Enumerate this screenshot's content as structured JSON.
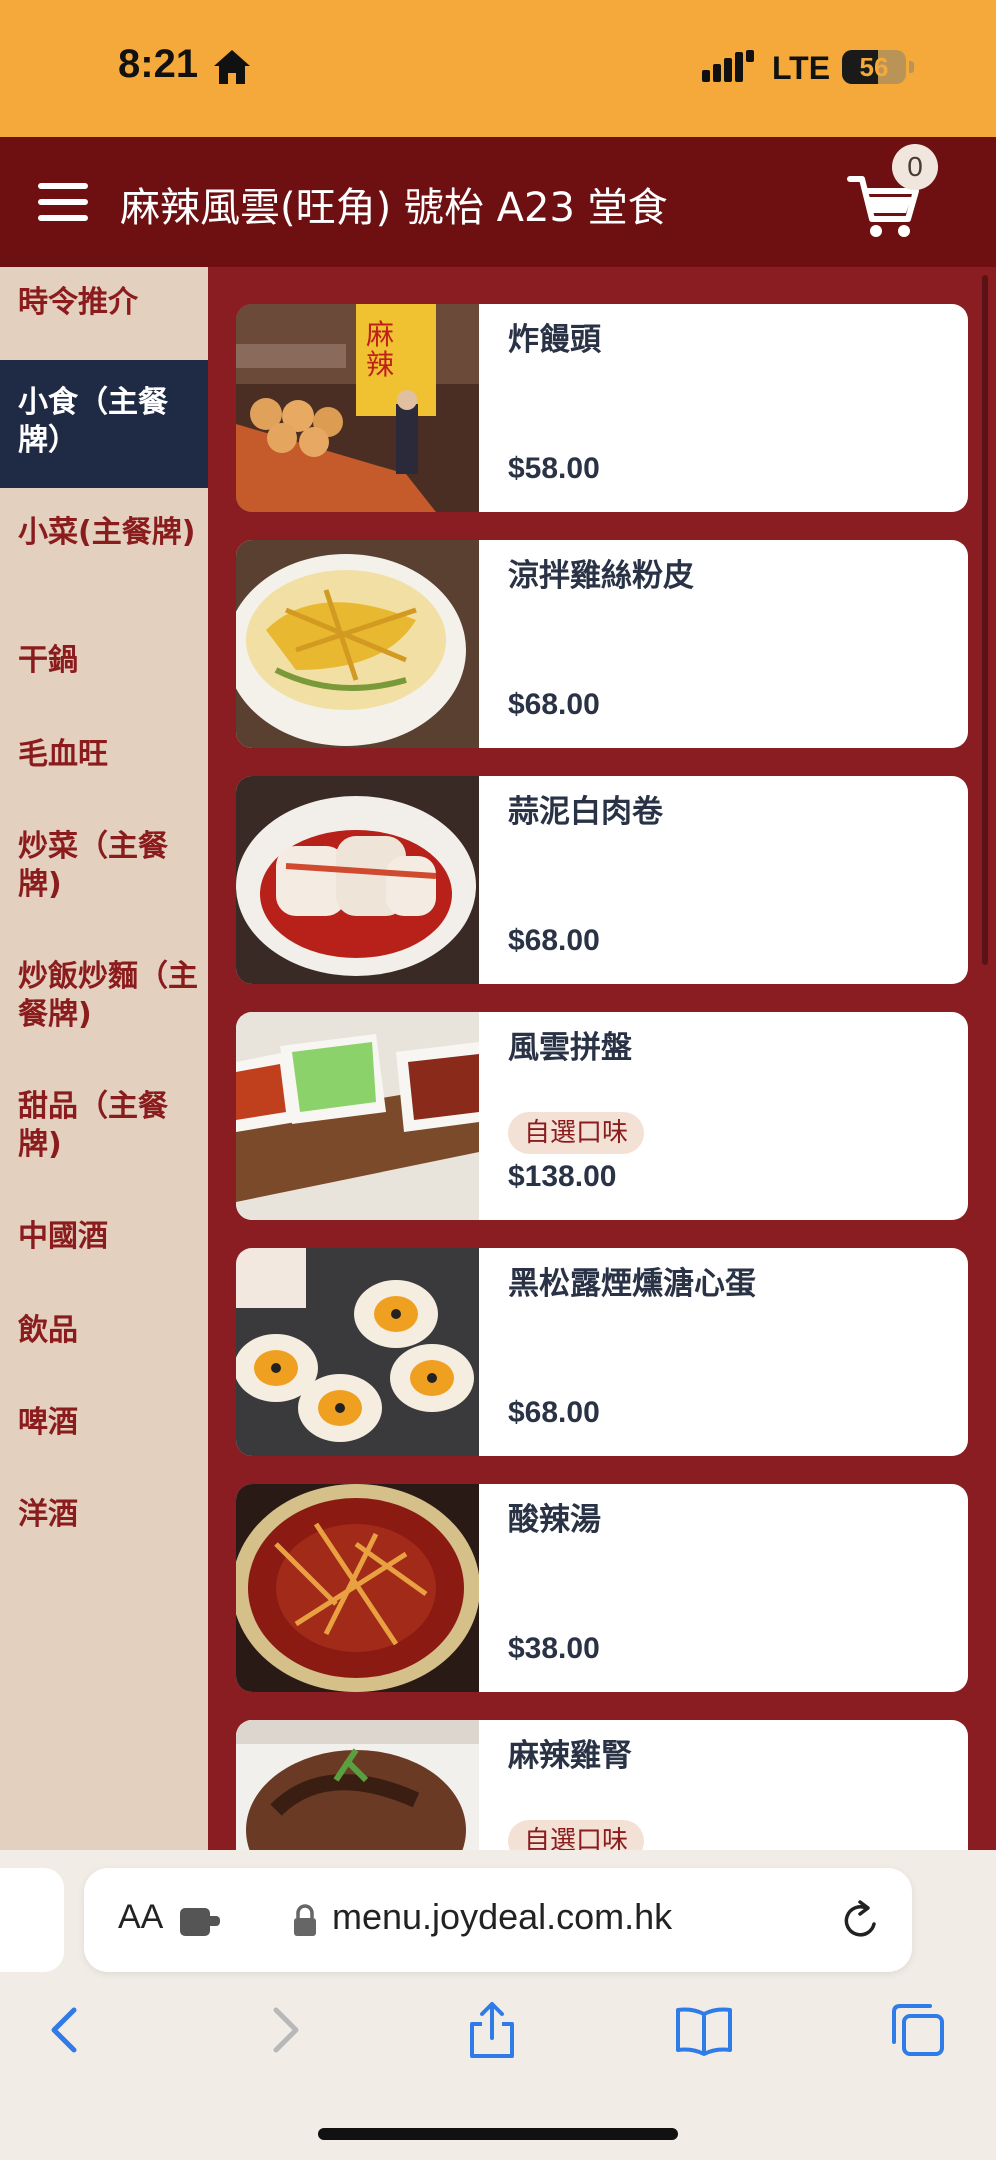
{
  "status_bar": {
    "time": "8:21",
    "network": "LTE",
    "battery_level": 56,
    "battery_text": "56"
  },
  "header": {
    "title": "麻辣風雲(旺角) 號枱 A23 堂食",
    "cart_count": "0"
  },
  "sidebar": {
    "items": [
      {
        "label": "時令推介",
        "active": false
      },
      {
        "label": "小食（主餐牌）",
        "active": true
      },
      {
        "label": "小菜(主餐牌)",
        "active": false
      },
      {
        "label": "干鍋",
        "active": false
      },
      {
        "label": "毛血旺",
        "active": false
      },
      {
        "label": "炒菜（主餐牌)",
        "active": false
      },
      {
        "label": "炒飯炒麵（主餐牌)",
        "active": false
      },
      {
        "label": "甜品（主餐牌)",
        "active": false
      },
      {
        "label": "中國酒",
        "active": false
      },
      {
        "label": "飲品",
        "active": false
      },
      {
        "label": "啤酒",
        "active": false
      },
      {
        "label": "洋酒",
        "active": false
      }
    ]
  },
  "menu_items": [
    {
      "name": "炸饅頭",
      "price": "$58.00",
      "tag": ""
    },
    {
      "name": "涼拌雞絲粉皮",
      "price": "$68.00",
      "tag": ""
    },
    {
      "name": "蒜泥白肉卷",
      "price": "$68.00",
      "tag": ""
    },
    {
      "name": "風雲拼盤",
      "price": "$138.00",
      "tag": "自選口味"
    },
    {
      "name": "黑松露煙燻溏心蛋",
      "price": "$68.00",
      "tag": ""
    },
    {
      "name": "酸辣湯",
      "price": "$38.00",
      "tag": ""
    },
    {
      "name": "麻辣雞腎",
      "price": "",
      "tag": "自選口味"
    }
  ],
  "browser": {
    "aa_label": "AA",
    "url": "menu.joydeal.com.hk"
  },
  "colors": {
    "status_bar": "#f4a93a",
    "header": "#6e0f12",
    "sidebar": "#e3d0bf",
    "sidebar_active": "#1f2a44",
    "list_background": "#8a1d22",
    "accent_text": "#8b1c1e"
  },
  "icons": [
    "home-icon",
    "signal-icon",
    "battery-icon",
    "hamburger-menu-icon",
    "cart-icon",
    "extension-icon",
    "lock-icon",
    "reload-icon",
    "back-icon",
    "forward-icon",
    "share-icon",
    "bookmarks-icon",
    "tabs-icon"
  ]
}
